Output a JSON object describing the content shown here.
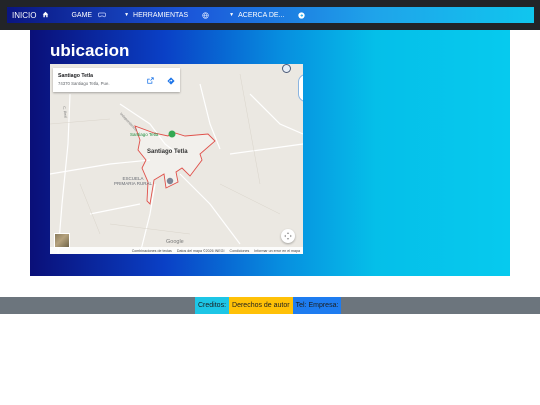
{
  "nav": {
    "home_label": "INICIO",
    "game_label": "GAME",
    "tools_label": "HERRAMIENTAS",
    "about_label": "ACERCA DE..."
  },
  "page": {
    "title": "ubicacion"
  },
  "map": {
    "place_name": "Santiago Tetla",
    "place_address": "74370 Santiago Tetla, Pue.",
    "town_label": "Santiago Tetla",
    "poi_label": "Santiago Tetla",
    "school_label_line1": "ESCUELA",
    "school_label_line2": "PRIMARIA RURAL",
    "road_label_1": "Independencia",
    "road_label_2": "C. Real",
    "logo_text": "Google",
    "footer_links": [
      "Combinaciones de teclas",
      "Datos del mapa ©2026 INEGI",
      "Condiciones",
      "Informar un error en el mapa"
    ]
  },
  "footer": {
    "credits_label": "Creditos:",
    "rights_label": "Derechos de autor",
    "phone_label": "Tel: Empresa:"
  },
  "colors": {
    "nav_start": "#0a1580",
    "nav_end": "#10c6ee",
    "footer_credits": "#1dc6e6",
    "footer_rights": "#ffc107",
    "footer_phone": "#1e7cf0",
    "boundary": "#e0504a"
  },
  "icons": {
    "home": "home-icon",
    "game": "gamepad-icon",
    "tools": "globe-icon",
    "about": "info-circle-icon"
  }
}
